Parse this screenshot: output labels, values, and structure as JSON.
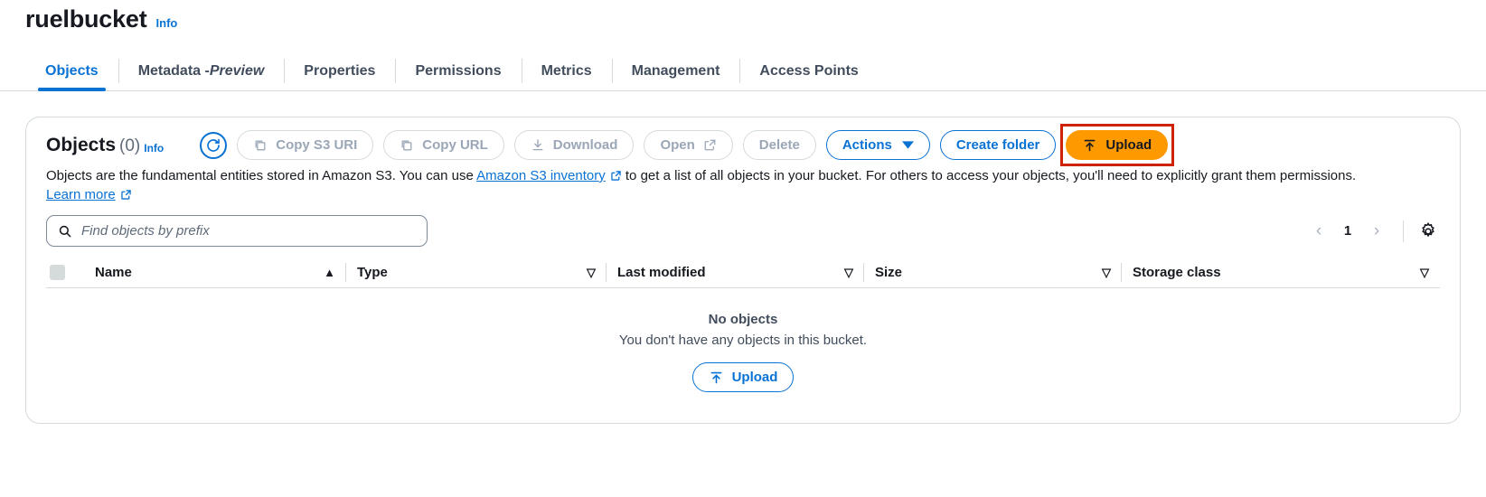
{
  "header": {
    "bucket_name": "ruelbucket",
    "info_label": "Info"
  },
  "tabs": [
    {
      "label": "Objects",
      "active": true
    },
    {
      "label": "Metadata - ",
      "italic_suffix": "Preview",
      "active": false
    },
    {
      "label": "Properties",
      "active": false
    },
    {
      "label": "Permissions",
      "active": false
    },
    {
      "label": "Metrics",
      "active": false
    },
    {
      "label": "Management",
      "active": false
    },
    {
      "label": "Access Points",
      "active": false
    }
  ],
  "panel": {
    "title": "Objects",
    "count": "(0)",
    "info_label": "Info",
    "refresh_icon": "refresh-icon",
    "toolbar": [
      {
        "label": "Copy S3 URI",
        "icon": "copy-icon",
        "state": "disabled"
      },
      {
        "label": "Copy URL",
        "icon": "copy-icon",
        "state": "disabled"
      },
      {
        "label": "Download",
        "icon": "download-icon",
        "state": "disabled"
      },
      {
        "label": "Open",
        "icon": "external-link-icon",
        "state": "disabled"
      },
      {
        "label": "Delete",
        "icon": "none",
        "state": "disabled"
      },
      {
        "label": "Actions",
        "icon": "chevron-down-icon",
        "state": "normal"
      },
      {
        "label": "Create folder",
        "icon": "none",
        "state": "normal"
      },
      {
        "label": "Upload",
        "icon": "upload-icon",
        "state": "primary"
      }
    ],
    "description": {
      "part1": "Objects are the fundamental entities stored in Amazon S3. You can use ",
      "link1": "Amazon S3 inventory",
      "part2": " to get a list of all objects in your bucket. For others to access your objects, you'll need to explicitly grant them permissions. ",
      "link2": "Learn more"
    },
    "search": {
      "placeholder": "Find objects by prefix",
      "value": "",
      "icon": "search-icon"
    },
    "pagination": {
      "prev": "‹",
      "page": "1",
      "next": "›",
      "settings_icon": "gear-icon"
    },
    "table": {
      "columns": [
        {
          "label": "Name",
          "sort": "▲"
        },
        {
          "label": "Type",
          "sort": "▽"
        },
        {
          "label": "Last modified",
          "sort": "▽"
        },
        {
          "label": "Size",
          "sort": "▽"
        },
        {
          "label": "Storage class",
          "sort": "▽"
        }
      ],
      "rows": []
    },
    "empty_state": {
      "title": "No objects",
      "subtitle": "You don't have any objects in this bucket.",
      "button_label": "Upload",
      "button_icon": "upload-icon"
    }
  },
  "colors": {
    "accent_blue": "#0972d3",
    "primary_orange": "#ff9900",
    "highlight_red": "#cc2200",
    "text_dark": "#16191f",
    "text_muted": "#5f6b7a",
    "border": "#d5dbdb"
  }
}
